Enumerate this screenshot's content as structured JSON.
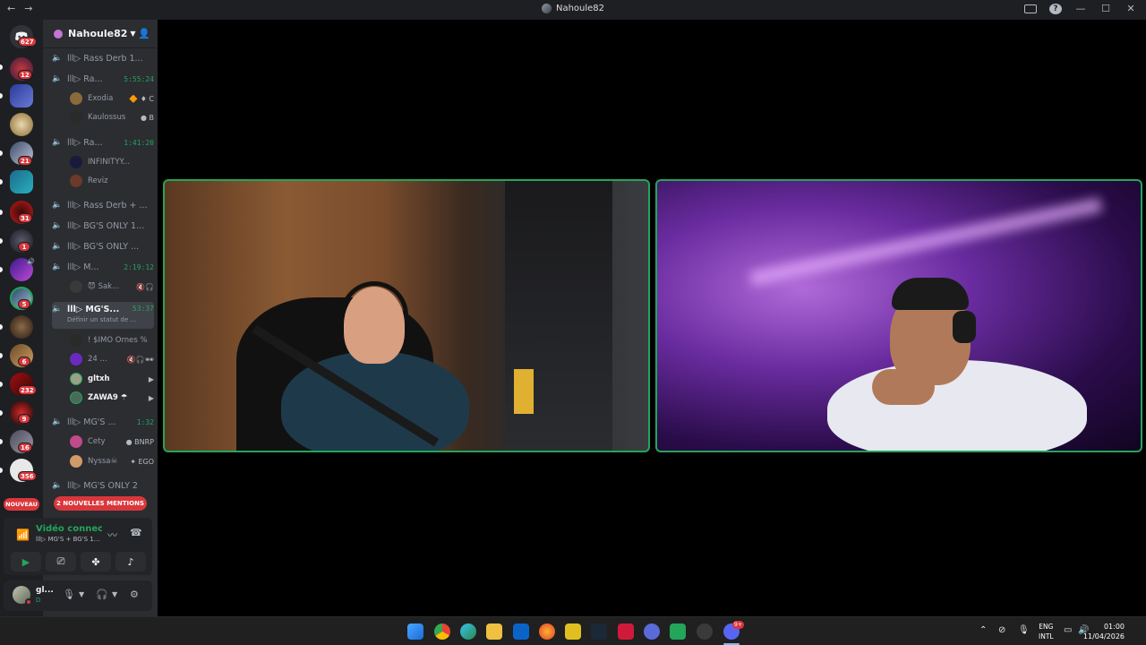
{
  "window": {
    "title": "Nahoule82",
    "nav_back": "←",
    "nav_forward": "→"
  },
  "server_rail": {
    "badges": [
      "627",
      "12",
      "21",
      "31",
      "1",
      "5",
      "6",
      "232",
      "9",
      "16",
      "356"
    ],
    "new_label": "NOUVEAU"
  },
  "sidebar": {
    "server_name": "Nahoule82",
    "channels": [
      {
        "name": "lll▷ Rass Derb 1...",
        "time": "",
        "live": false
      },
      {
        "name": "lll▷ Ra...",
        "time": "5:55:24",
        "live": true
      },
      {
        "name": "lll▷ Ra...",
        "time": "1:41:20",
        "live": true
      },
      {
        "name": "lll▷ Rass Derb + ...",
        "time": "",
        "live": false
      },
      {
        "name": "lll▷ BG'S ONLY 1...",
        "time": "",
        "live": false
      },
      {
        "name": "lll▷ BG'S ONLY ...",
        "time": "",
        "live": false
      },
      {
        "name": "lll▷ M...",
        "time": "2:19:12",
        "live": true
      },
      {
        "name": "lll▷ MG'S...",
        "time": "53:37",
        "live": true,
        "sub": "Définir un statut de ..."
      },
      {
        "name": "lll▷ MG'S ...",
        "time": "1:32",
        "live": true
      },
      {
        "name": "lll▷ MG'S ONLY 2",
        "time": "",
        "live": false
      }
    ],
    "users": [
      {
        "name": "Exodia",
        "status": "🔶 ♦ C"
      },
      {
        "name": "Kaulossus",
        "status": "● B"
      },
      {
        "name": "INFINITYY...",
        "status": ""
      },
      {
        "name": "Reviz",
        "status": ""
      },
      {
        "name": "😈 Sak...",
        "status": "🔇🎧"
      },
      {
        "name": "! $IMO Ornes %",
        "status": ""
      },
      {
        "name": "24 ...",
        "status": "🔇🎧🕶"
      },
      {
        "name": "gltxh",
        "status": "▶"
      },
      {
        "name": "ZAWA9 ☂",
        "status": "▶"
      },
      {
        "name": "Cety",
        "status": "● BNRP"
      },
      {
        "name": "Nyssa☠",
        "status": "✦ EGO"
      }
    ],
    "mentions_label": "2 NOUVELLES MENTIONS"
  },
  "voice_panel": {
    "title": "Vidéo connectée",
    "subtitle": "lll▷ MG'S + BG'S 1..."
  },
  "user_panel": {
    "name": "gl...",
    "status": "D"
  },
  "taskbar": {
    "lang_top": "ENG",
    "lang_bottom": "INTL",
    "time": "01:00",
    "date": "11/04/2026",
    "discord_badge": "9+"
  },
  "colors": {
    "accent_green": "#23a55a",
    "danger_red": "#da373c",
    "sidebar_bg": "#2b2d31",
    "rail_bg": "#1e1f22"
  }
}
